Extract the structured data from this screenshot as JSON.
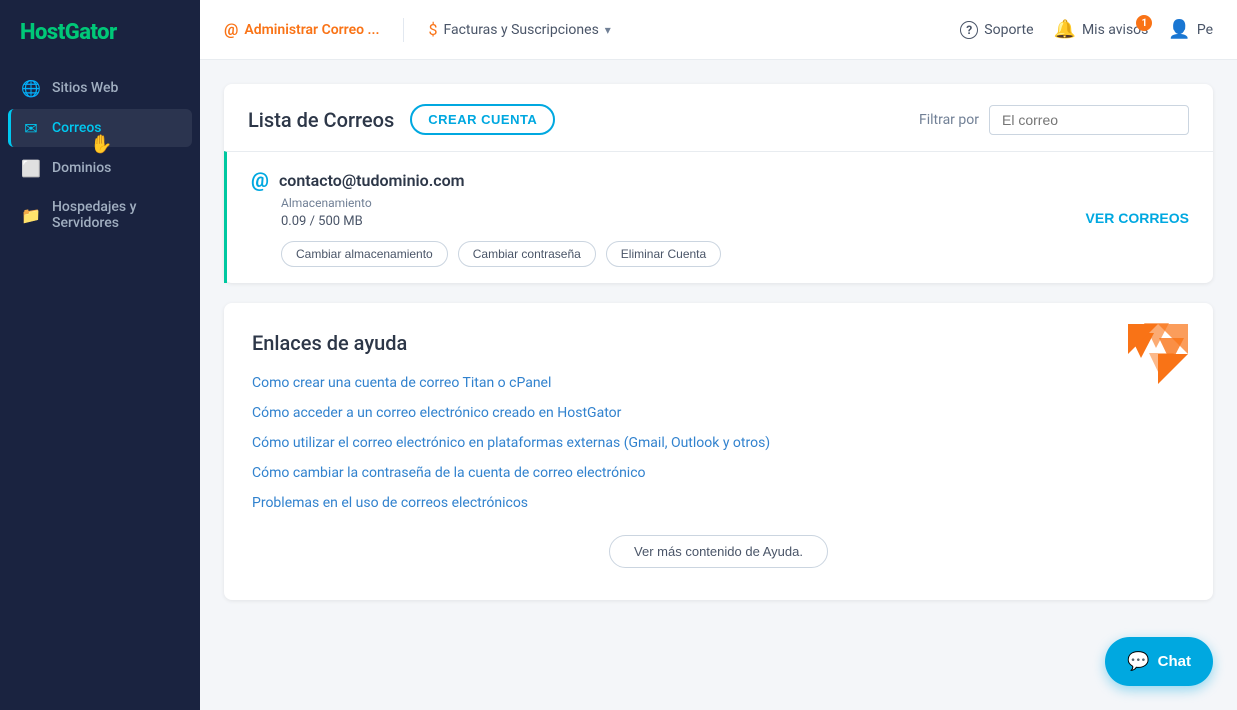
{
  "sidebar": {
    "logo": {
      "text": "HostGator"
    },
    "items": [
      {
        "id": "sitios-web",
        "label": "Sitios Web",
        "icon": "🌐",
        "active": false
      },
      {
        "id": "correos",
        "label": "Correos",
        "icon": "✉",
        "active": true
      },
      {
        "id": "dominios",
        "label": "Dominios",
        "icon": "⬜",
        "active": false
      },
      {
        "id": "hospedajes",
        "label": "Hospedajes y Servidores",
        "icon": "📁",
        "active": false
      }
    ]
  },
  "topnav": {
    "items": [
      {
        "id": "admin-correo",
        "label": "Administrar Correo ...",
        "icon": "@",
        "active": true
      },
      {
        "id": "facturas",
        "label": "Facturas y Suscripciones",
        "icon": "$",
        "active": false
      }
    ],
    "support": {
      "label": "Soporte",
      "icon": "?"
    },
    "notifications": {
      "label": "Mis avisos",
      "badge": "1"
    },
    "user": {
      "label": "Pe"
    }
  },
  "page": {
    "title": "Lista de Correos",
    "create_button": "CREAR CUENTA",
    "filter_label": "Filtrar por",
    "filter_placeholder": "El correo"
  },
  "email_accounts": [
    {
      "address": "contacto@tudominio.com",
      "storage_label": "Almacenamiento",
      "storage_value": "0.09 / 500 MB",
      "actions": [
        "Cambiar almacenamiento",
        "Cambiar contraseña",
        "Eliminar Cuenta"
      ],
      "view_button": "VER CORREOS"
    }
  ],
  "help": {
    "title": "Enlaces de ayuda",
    "links": [
      "Como crear una cuenta de correo Titan o cPanel",
      "Cómo acceder a un correo electrónico creado en HostGator",
      "Cómo utilizar el correo electrónico en plataformas externas (Gmail, Outlook y otros)",
      "Cómo cambiar la contraseña de la cuenta de correo electrónico",
      "Problemas en el uso de correos electrónicos"
    ],
    "more_button": "Ver más contenido de Ayuda."
  },
  "chat": {
    "label": "Chat",
    "icon": "💬"
  }
}
